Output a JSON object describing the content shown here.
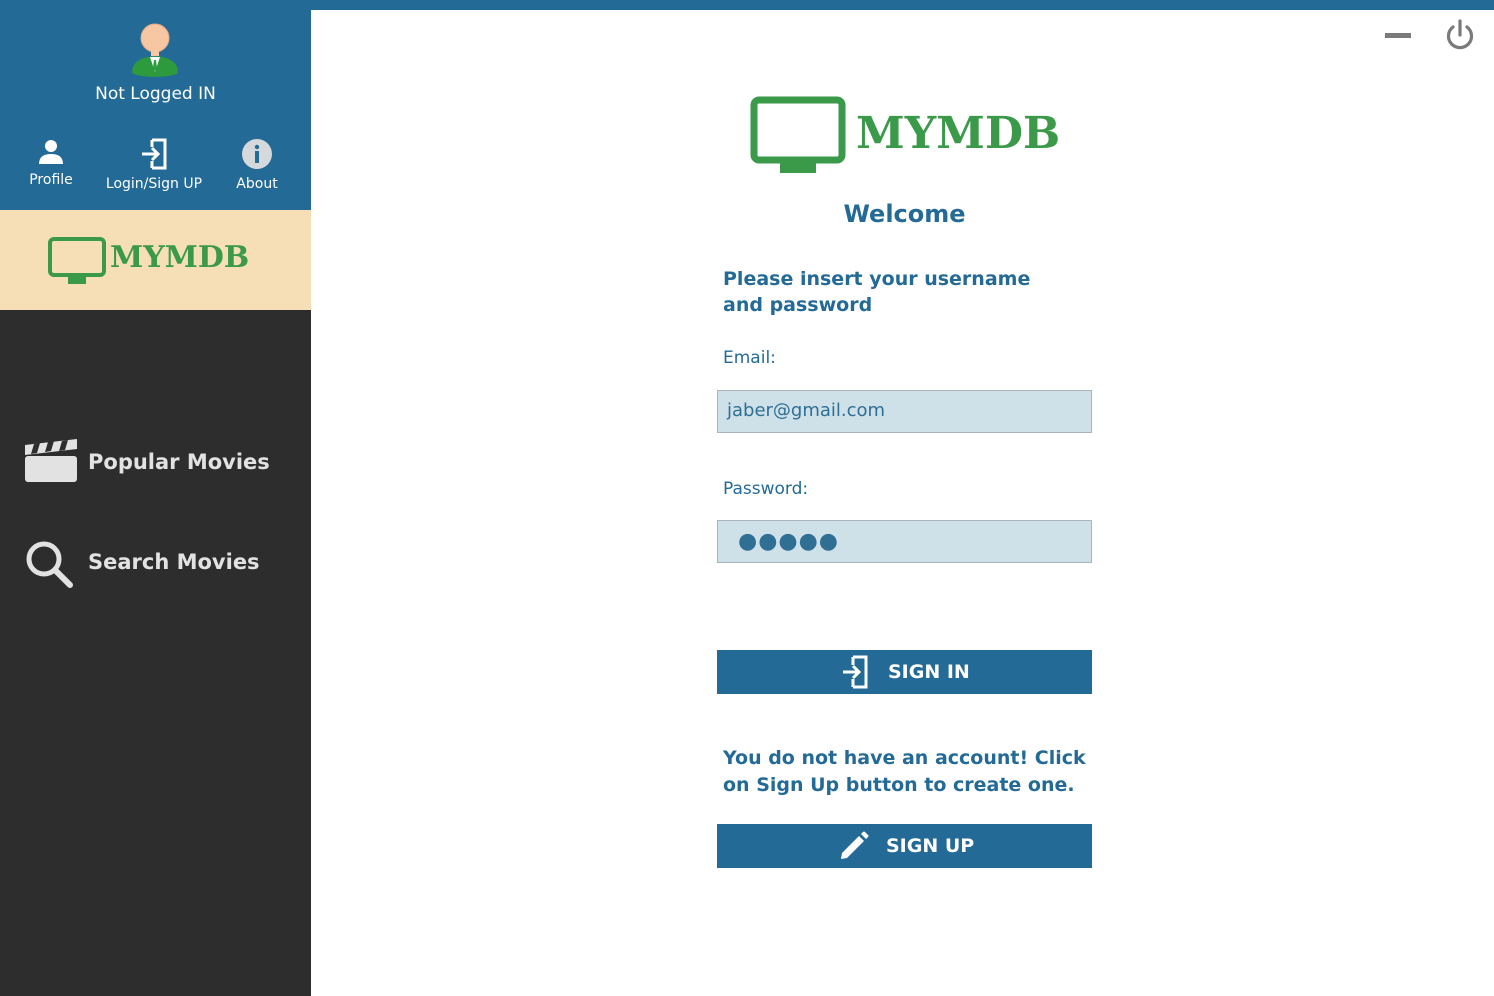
{
  "user": {
    "status": "Not Logged IN"
  },
  "nav": {
    "profile": "Profile",
    "login": "Login/Sign UP",
    "about": "About"
  },
  "brand": {
    "name": "MYMDB"
  },
  "menu": {
    "popular": "Popular Movies",
    "search": "Search Movies"
  },
  "login": {
    "welcome": "Welcome",
    "instruction": "Please insert your username and password",
    "email_label": "Email:",
    "email_value": "jaber@gmail.com",
    "password_label": "Password:",
    "password_mask": "●●●●●",
    "signin_label": "SIGN IN",
    "no_account_text": "You do not have an account! Click on Sign Up button to create one.",
    "signup_label": "SIGN UP"
  },
  "colors": {
    "primary": "#236a97",
    "sidebar": "#2d2d2d",
    "logo_bg": "#f6deb6",
    "brand_green": "#3a9a4a",
    "field_bg": "#cee0e8"
  },
  "icons": [
    "person-icon",
    "login-icon",
    "info-icon",
    "clapperboard-icon",
    "search-icon",
    "minimize-icon",
    "power-icon",
    "tv-icon",
    "pencil-icon"
  ]
}
